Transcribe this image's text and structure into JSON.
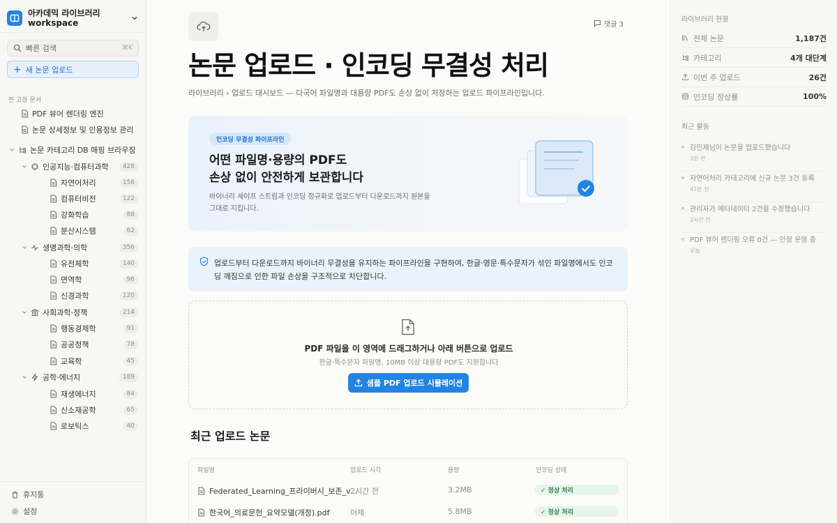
{
  "workspace": {
    "name": "아카데믹 라이브러리\nworkspace"
  },
  "sidebar": {
    "search_label": "빠른 검색",
    "search_shortcut": "⌘K",
    "new_upload": "새 논문 업로드",
    "pinned_header": "핀 고정 문서",
    "pinned": [
      "PDF 뷰어 렌더링 엔진",
      "논문 상세정보 및 인용정보 관리"
    ],
    "tree_root": "논문 카테고리 DB 매핑 브라우징",
    "categories": [
      {
        "label": "인공지능·컴퓨터과학",
        "count": "428",
        "icon": "chip-icon",
        "children": [
          {
            "label": "자연어처리",
            "count": "156"
          },
          {
            "label": "컴퓨터비전",
            "count": "122"
          },
          {
            "label": "강화학습",
            "count": "88"
          },
          {
            "label": "분산시스템",
            "count": "62"
          }
        ]
      },
      {
        "label": "생명과학·의학",
        "count": "356",
        "icon": "pulse-icon",
        "children": [
          {
            "label": "유전체학",
            "count": "140"
          },
          {
            "label": "면역학",
            "count": "96"
          },
          {
            "label": "신경과학",
            "count": "120"
          }
        ]
      },
      {
        "label": "사회과학·정책",
        "count": "214",
        "icon": "building-icon",
        "children": [
          {
            "label": "행동경제학",
            "count": "91"
          },
          {
            "label": "공공정책",
            "count": "78"
          },
          {
            "label": "교육학",
            "count": "45"
          }
        ]
      },
      {
        "label": "공학·에너지",
        "count": "189",
        "icon": "bolt-icon",
        "children": [
          {
            "label": "재생에너지",
            "count": "84"
          },
          {
            "label": "신소재공학",
            "count": "65"
          },
          {
            "label": "로보틱스",
            "count": "40"
          }
        ]
      }
    ],
    "trash": "휴지통",
    "settings": "설정"
  },
  "page": {
    "comments": "댓글 3",
    "title": "논문 업로드 · 인코딩 무결성 처리",
    "breadcrumb": "라이브러리 › 업로드 대시보드 — 다국어 파일명과 대용량 PDF도 손상 없이 저장하는 업로드 파이프라인입니다.",
    "hero": {
      "badge": "인코딩 무결성 파이프라인",
      "heading": "어떤 파일명·용량의 PDF도\n손상 없이 안전하게 보관합니다",
      "desc": "바이너리 세이프 스트림과 인코딩 정규화로 업로드부터 다운로드까지 원본을 그대로 지킵니다."
    },
    "notice": "업로드부터 다운로드까지 바이너리 무결성을 유지하는 파이프라인을 구현하여, 한글·영문·특수문자가 섞인 파일명에서도 인코딩 깨짐으로 인한 파일 손상을 구조적으로 차단합니다.",
    "dropzone": {
      "title": "PDF 파일을 이 영역에 드래그하거나 아래 버튼으로 업로드",
      "subtitle": "한글·특수문자 파일명, 10MB 이상 대용량 PDF도 지원합니다",
      "button": "샘플 PDF 업로드 시뮬레이션"
    },
    "recent_title": "최근 업로드 논문",
    "table": {
      "headers": [
        "파일명",
        "업로드 시각",
        "용량",
        "인코딩 상태"
      ],
      "rows": [
        {
          "file": "Federated_Learning_프라이버시_보존_v...",
          "time": "2시간 전",
          "size": "3.2MB",
          "status": "✓ 정상 처리"
        },
        {
          "file": "한국어_의료문헌_요약모델(개정).pdf",
          "time": "어제",
          "size": "5.8MB",
          "status": "✓ 정상 처리"
        }
      ]
    }
  },
  "panel": {
    "stats_title": "라이브러리 현황",
    "stats": [
      {
        "label": "전체 논문",
        "value": "1,187건",
        "icon": "books-icon"
      },
      {
        "label": "카테고리",
        "value": "4개 대단계",
        "icon": "tree-icon"
      },
      {
        "label": "이번 주 업로드",
        "value": "26건",
        "icon": "upload-icon"
      },
      {
        "label": "인코딩 정상률",
        "value": "100%",
        "icon": "database-icon"
      }
    ],
    "activity_title": "최근 활동",
    "activity": [
      {
        "text": "김민재님이 논문을 업로드했습니다",
        "time": "3분 전"
      },
      {
        "text": "자연어처리 카테고리에 신규 논문 3건 등록",
        "time": "41분 전"
      },
      {
        "text": "관리자가 메타데이터 2건을 수정했습니다",
        "time": "2시간 전"
      },
      {
        "text": "PDF 뷰어 렌더링 오류 0건 — 안정 운영 중",
        "time": "오늘"
      }
    ]
  },
  "colors": {
    "accent": "#2383e2",
    "success_bg": "#e6f4ea",
    "success_fg": "#2e7d4f"
  }
}
